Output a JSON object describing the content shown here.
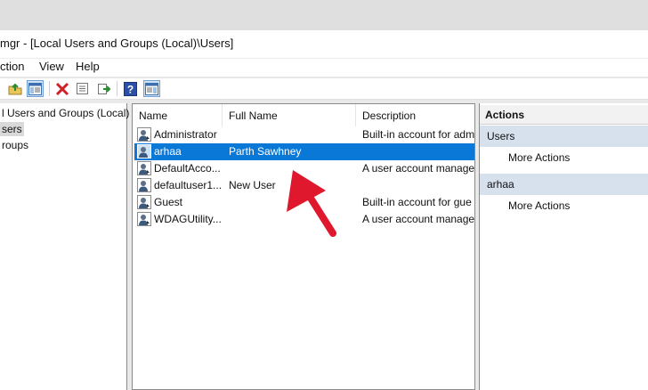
{
  "window": {
    "title": "mgr - [Local Users and Groups (Local)\\Users]"
  },
  "menu": {
    "items": [
      {
        "label": "ction"
      },
      {
        "label": "View"
      },
      {
        "label": "Help"
      }
    ]
  },
  "toolbar": {
    "icons": [
      "up-folder-icon",
      "show-hide-tree-icon",
      "delete-icon",
      "properties-icon",
      "export-list-icon",
      "help-icon",
      "show-hide-action-pane-icon"
    ]
  },
  "tree": {
    "items": [
      {
        "label": "l Users and Groups (Local)",
        "selected": false
      },
      {
        "label": "sers",
        "selected": true
      },
      {
        "label": "roups",
        "selected": false
      }
    ]
  },
  "list": {
    "columns": [
      {
        "label": "Name"
      },
      {
        "label": "Full Name"
      },
      {
        "label": "Description"
      }
    ],
    "rows": [
      {
        "name": "Administrator",
        "full_name": "",
        "description": "Built-in account for adm",
        "selected": false
      },
      {
        "name": "arhaa",
        "full_name": "Parth Sawhney",
        "description": "",
        "selected": true
      },
      {
        "name": "DefaultAcco...",
        "full_name": "",
        "description": "A user account manage",
        "selected": false
      },
      {
        "name": "defaultuser1...",
        "full_name": "New User",
        "description": "",
        "selected": false
      },
      {
        "name": "Guest",
        "full_name": "",
        "description": "Built-in account for gue",
        "selected": false
      },
      {
        "name": "WDAGUtility...",
        "full_name": "",
        "description": "A user account manage",
        "selected": false
      }
    ]
  },
  "actions": {
    "header": "Actions",
    "sections": [
      {
        "title": "Users",
        "link": "More Actions"
      },
      {
        "title": "arhaa",
        "link": "More Actions"
      }
    ]
  },
  "colors": {
    "selection": "#0a78d7",
    "arrow": "#e0182d",
    "section_bg": "#d7e1ee"
  }
}
